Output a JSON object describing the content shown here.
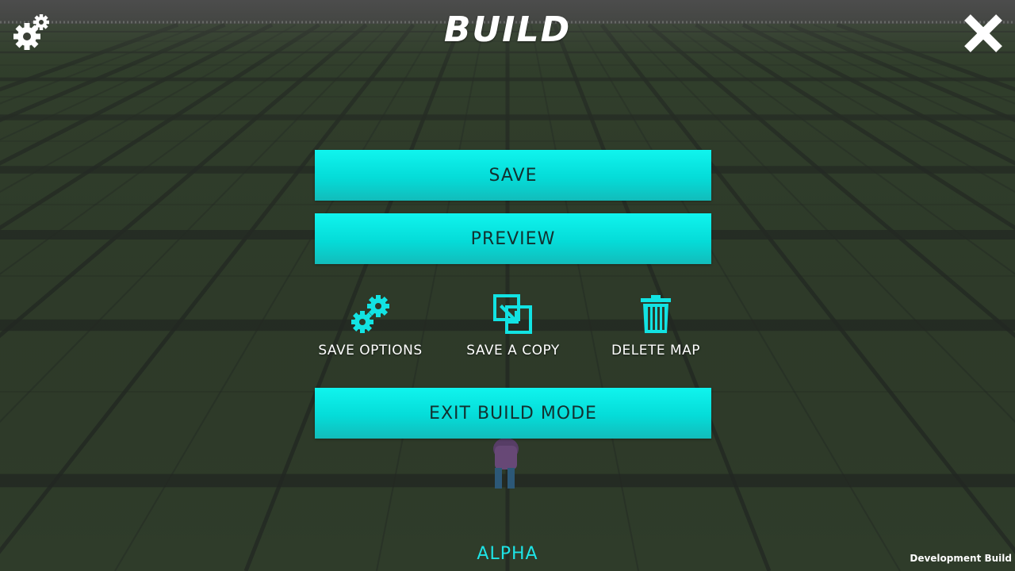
{
  "header": {
    "title": "BUILD"
  },
  "menu": {
    "save_label": "SAVE",
    "preview_label": "PREVIEW",
    "exit_label": "EXIT BUILD MODE",
    "options": [
      {
        "label": "SAVE OPTIONS",
        "icon": "gears-icon"
      },
      {
        "label": "SAVE A COPY",
        "icon": "copy-icon"
      },
      {
        "label": "DELETE MAP",
        "icon": "trash-icon"
      }
    ]
  },
  "footer": {
    "version": "ALPHA",
    "build": "Development Build"
  },
  "colors": {
    "accent": "#05e8e4",
    "button_text": "#13302f",
    "version_text": "#1ee3e6",
    "ground": "#2f3a2a"
  }
}
